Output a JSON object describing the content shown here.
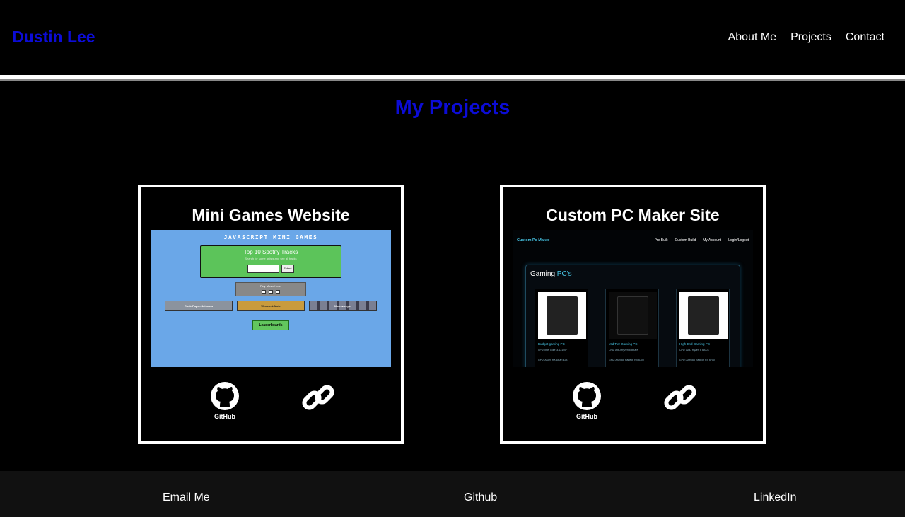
{
  "header": {
    "brand": "Dustin Lee",
    "nav": [
      "About Me",
      "Projects",
      "Contact"
    ]
  },
  "main": {
    "title": "My Projects",
    "projects": [
      {
        "title": "Mini Games Website",
        "icons": [
          "github-icon",
          "link-icon"
        ],
        "github_label": "GitHub",
        "screenshot": {
          "heading": "JAVASCRIPT MINI GAMES",
          "spotify_title": "Top 10 Spotify Tracks",
          "spotify_sub": "Search for some artists and see all tracks",
          "submit": "Submit",
          "play_label": "Play Music Here!",
          "games": [
            "Rock-Paper-Scissors",
            "Whack-A-Mole",
            "Minesweeper"
          ],
          "leaderboards": "Leaderboards"
        }
      },
      {
        "title": "Custom PC Maker Site",
        "icons": [
          "github-icon",
          "link-icon"
        ],
        "github_label": "GitHub",
        "screenshot": {
          "brand": "Custom Pc Maker",
          "nav": [
            "Pre Built",
            "Custom Build",
            "My Account",
            "Login/Logout"
          ],
          "panel_title_a": "Gaming",
          "panel_title_b": "PC's",
          "items": [
            {
              "name": "Budget gaming PC",
              "cpu": "CPU: Intel Core i3-12100F",
              "gpu": "GPU: ASUS RX 6400 4GB"
            },
            {
              "name": "Mid Tier Gaming PC",
              "cpu": "CPU: AMD Ryzen 5 5600X",
              "gpu": "GPU: ASRock Radeon RX 6700"
            },
            {
              "name": "High End Gaming PC",
              "cpu": "CPU: AMD Ryzen 5 5600X",
              "gpu": "GPU: ASRock Radeon RX 6700"
            }
          ]
        }
      }
    ]
  },
  "footer": {
    "links": [
      "Email Me",
      "Github",
      "LinkedIn"
    ]
  },
  "colors": {
    "accent": "#0c0cd6",
    "background": "#000000",
    "footer_bg": "#111111",
    "pc_accent": "#48c8e8"
  }
}
